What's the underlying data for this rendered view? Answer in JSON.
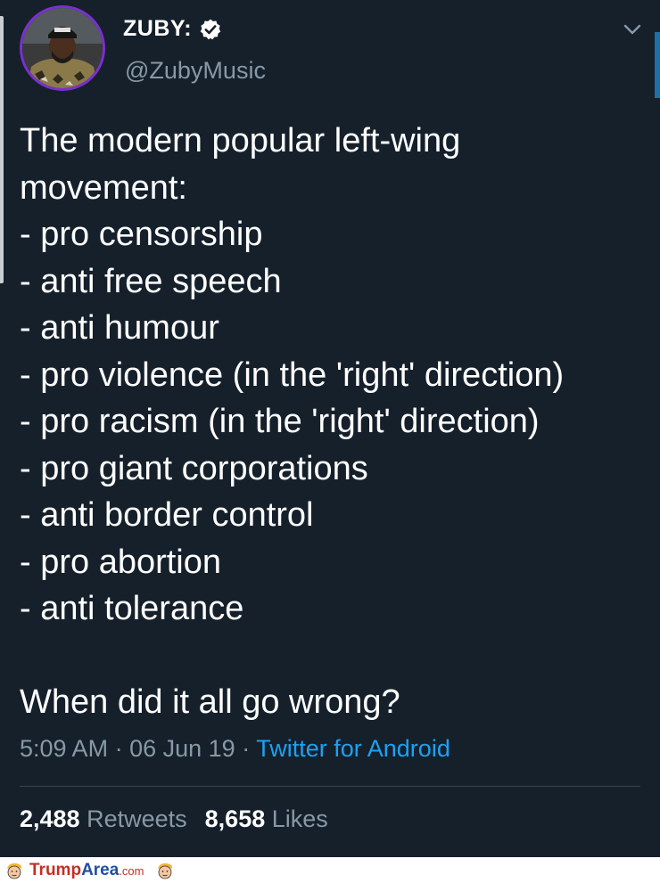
{
  "header": {
    "display_name": "ZUBY:",
    "handle": "@ZubyMusic",
    "verified_icon": "verified-badge-icon",
    "menu_icon": "chevron-down-icon"
  },
  "tweet": {
    "lines": [
      "The modern popular left-wing",
      "movement:",
      "- pro censorship",
      "- anti free speech",
      "- anti humour",
      "- pro violence (in the 'right' direction)",
      "- pro racism (in the 'right' direction)",
      "- pro giant corporations",
      "- anti border control",
      "- pro abortion",
      "- anti tolerance"
    ],
    "closing": "When did it all go wrong?"
  },
  "meta": {
    "time": "5:09 AM",
    "separator": "·",
    "date": "06 Jun 19",
    "source": "Twitter for Android"
  },
  "stats": {
    "retweets_count": "2,488",
    "retweets_label": "Retweets",
    "likes_count": "8,658",
    "likes_label": "Likes"
  },
  "watermark": {
    "part1": "Trump",
    "part2": "Area",
    "part3": ".com"
  },
  "colors": {
    "background": "#15202b",
    "text": "#ffffff",
    "secondary": "#8899a6",
    "link": "#1da1f2",
    "avatar_ring": "#7b2fd1"
  }
}
